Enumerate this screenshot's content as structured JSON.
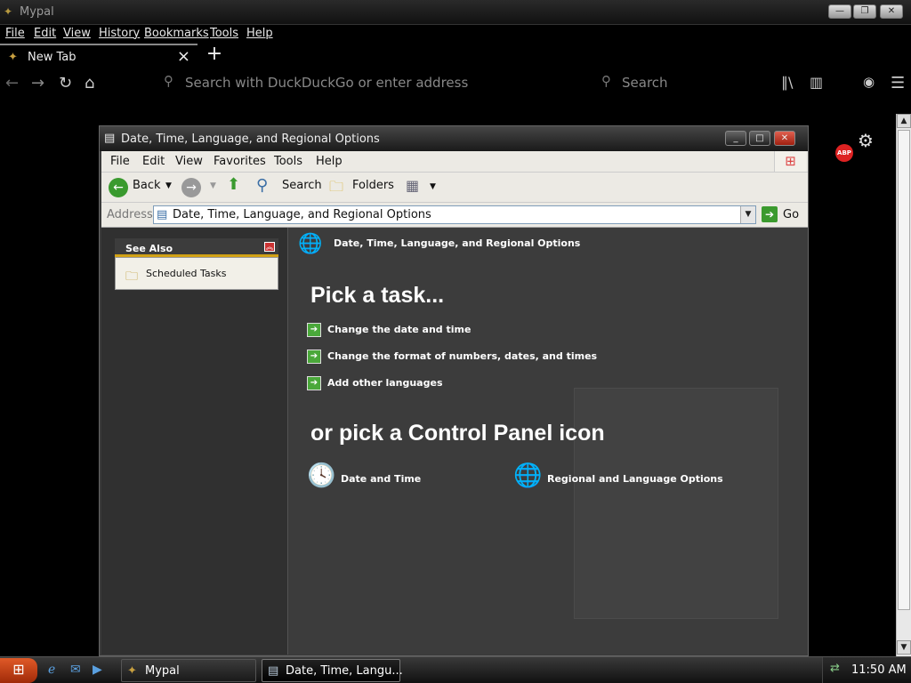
{
  "browser": {
    "title": "Mypal",
    "menu": [
      "File",
      "Edit",
      "View",
      "History",
      "Bookmarks",
      "Tools",
      "Help"
    ],
    "tab_label": "New Tab",
    "url_placeholder": "Search with DuckDuckGo or enter address",
    "search_placeholder": "Search",
    "abp_label": "ABP"
  },
  "explorer": {
    "title": "Date, Time, Language, and Regional Options",
    "menu": [
      "File",
      "Edit",
      "View",
      "Favorites",
      "Tools",
      "Help"
    ],
    "toolbar": {
      "back": "Back",
      "search": "Search",
      "folders": "Folders"
    },
    "address_label": "Address",
    "address_value": "Date, Time, Language, and Regional Options",
    "go_label": "Go",
    "see_also": {
      "header": "See Also",
      "items": [
        "Scheduled Tasks"
      ]
    },
    "header_title": "Date, Time, Language, and Regional Options",
    "pick_task": "Pick a task...",
    "tasks": [
      "Change the date and time",
      "Change the format of numbers, dates, and times",
      "Add other languages"
    ],
    "or_pick": "or pick a Control Panel icon",
    "icons": [
      "Date and Time",
      "Regional and Language Options"
    ]
  },
  "taskbar": {
    "buttons": [
      "Mypal",
      "Date, Time, Langu..."
    ],
    "clock": "11:50 AM"
  }
}
